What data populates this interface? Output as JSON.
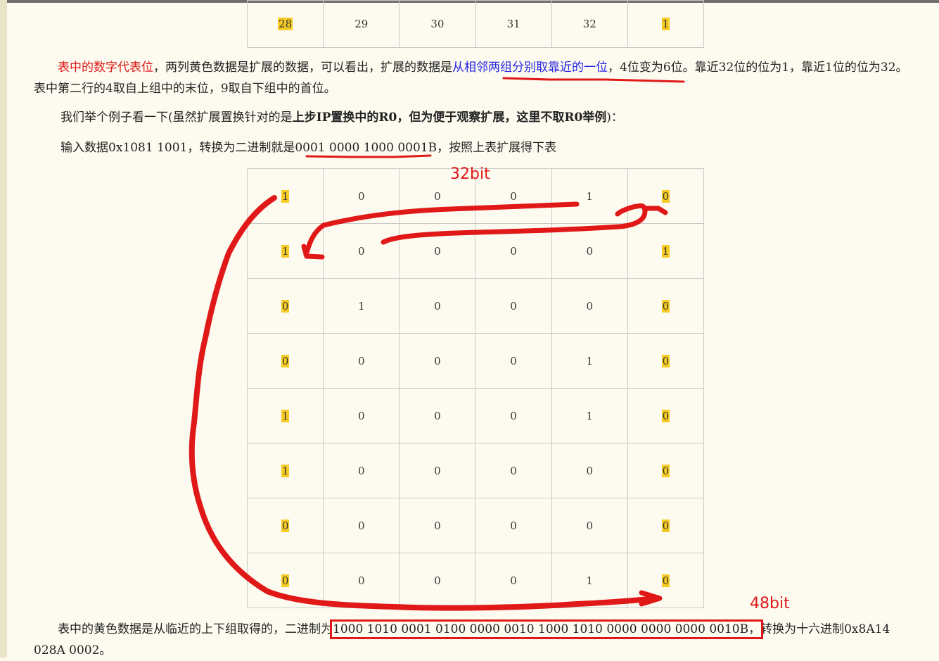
{
  "table_top": {
    "row": [
      {
        "text": "28",
        "highlight": true
      },
      {
        "text": "29",
        "highlight": false
      },
      {
        "text": "30",
        "highlight": false
      },
      {
        "text": "31",
        "highlight": false
      },
      {
        "text": "32",
        "highlight": false
      },
      {
        "text": "1",
        "highlight": true
      }
    ]
  },
  "para1": {
    "red": "表中的数字代表位",
    "mid1": "，两列黄色数据是扩展的数据，可以看出，扩展的数据是",
    "blue": "从相邻两组分别取靠近的一位",
    "rest": "，4位变为6位。靠近32位的位为1，靠近1位的位为32。表中第二行的4取自上组中的末位，9取自下组中的首位。"
  },
  "para2": {
    "start": "我们举个例子看一下(虽然扩展置换针对的是",
    "bold": "上步IP置换中的R0，但为便于观察扩展，这里不取R0举例",
    "end": ")："
  },
  "para3": {
    "start": "输入数据0x1081 1001，转换为二进制就是",
    "underlined": "0001 0000 1000 0001B",
    "end": "，按照上表扩展得下表"
  },
  "annotations": {
    "bits32": "32bit",
    "bits48": "48bit"
  },
  "table_main": {
    "rows": [
      [
        "1",
        "0",
        "0",
        "0",
        "1",
        "0"
      ],
      [
        "1",
        "0",
        "0",
        "0",
        "0",
        "1"
      ],
      [
        "0",
        "1",
        "0",
        "0",
        "0",
        "0"
      ],
      [
        "0",
        "0",
        "0",
        "0",
        "1",
        "0"
      ],
      [
        "1",
        "0",
        "0",
        "0",
        "1",
        "0"
      ],
      [
        "1",
        "0",
        "0",
        "0",
        "0",
        "0"
      ],
      [
        "0",
        "0",
        "0",
        "0",
        "0",
        "0"
      ],
      [
        "0",
        "0",
        "0",
        "0",
        "1",
        "0"
      ]
    ],
    "highlight_columns": [
      0,
      5
    ]
  },
  "para4": {
    "start": "表中的黄色数据是从临近的上下组取得的，二进制为",
    "boxed": "1000 1010 0001 0100 0000 0010 1000 1010 0000 0000 0000 0010B，",
    "end": "转换为十六进制0x8A14 028A 0002。"
  },
  "colors": {
    "highlight": "#f6cb24",
    "annotation_red": "#e01818",
    "link_blue": "#2424e0",
    "background": "#fdfbf0"
  }
}
